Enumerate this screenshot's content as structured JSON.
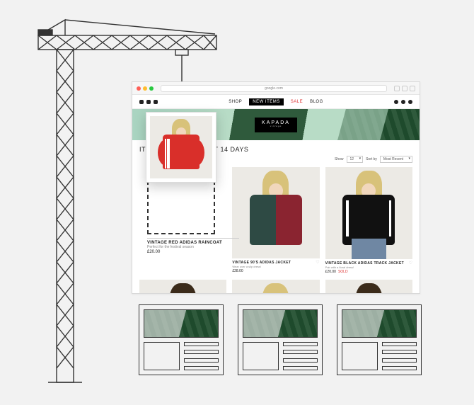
{
  "browser": {
    "url": "google.com"
  },
  "brand": {
    "name": "KAPADA",
    "tagline": "vintage"
  },
  "nav": {
    "shop": "SHOP",
    "new_items": "NEW ITEMS",
    "sale": "SALE",
    "blog": "BLOG"
  },
  "page": {
    "heading": "ITEMS FROM THE PAST 14 DAYS",
    "show_label": "Show",
    "show_value": "12",
    "sort_label": "Sort by",
    "sort_value": "Most Recent"
  },
  "lifted_product": {
    "name": "VINTAGE RED ADIDAS RAINCOAT",
    "sub": "Perfect for the festival season",
    "price": "£20.00"
  },
  "products": [
    {
      "name": "VINTAGE 90'S ADIDAS JACKET",
      "sub": "Wear over a slip dress!",
      "price": "£28.00",
      "sold": false,
      "style": "chevron"
    },
    {
      "name": "VINTAGE BLACK ADIDAS TRACK JACKET",
      "sub": "Pair with a floral dress!",
      "price": "£20.00",
      "sold": true,
      "style": "adidas"
    },
    {
      "name": "",
      "sub": "",
      "price": "",
      "sold": false,
      "style": "tee-dk dark"
    },
    {
      "name": "",
      "sub": "",
      "price": "",
      "sold": false,
      "style": "tee-gr"
    },
    {
      "name": "",
      "sub": "",
      "price": "",
      "sold": false,
      "style": "shirt-pt dark"
    }
  ],
  "sold_label": "SOLD"
}
